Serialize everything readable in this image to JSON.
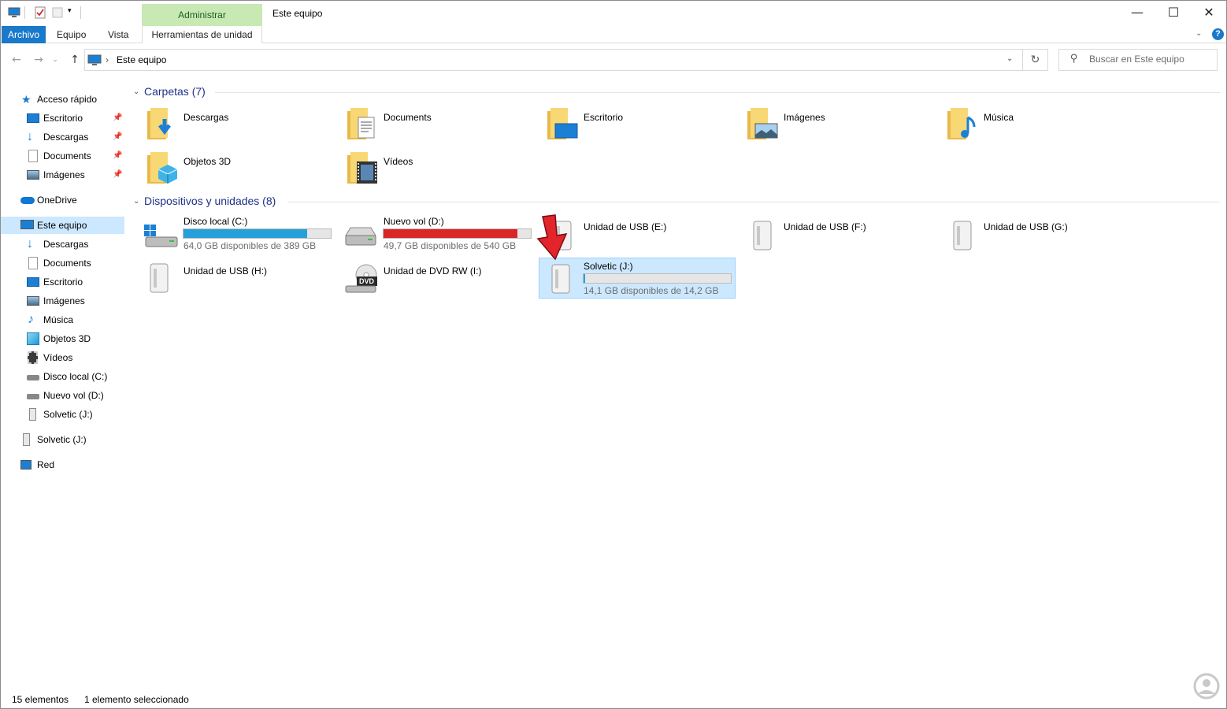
{
  "window": {
    "title": "Este equipo",
    "context_tab": "Administrar",
    "minimize": "—",
    "maximize": "☐",
    "close": "✕"
  },
  "ribbon": {
    "tabs": [
      "Archivo",
      "Equipo",
      "Vista",
      "Herramientas de unidad"
    ]
  },
  "address": {
    "path": "Este equipo",
    "separator": "›"
  },
  "search": {
    "placeholder": "Buscar en Este equipo"
  },
  "sidebar": {
    "quick_access": "Acceso rápido",
    "quick_items": [
      "Escritorio",
      "Descargas",
      "Documents",
      "Imágenes"
    ],
    "onedrive": "OneDrive",
    "this_pc": "Este equipo",
    "pc_items": [
      "Descargas",
      "Documents",
      "Escritorio",
      "Imágenes",
      "Música",
      "Objetos 3D",
      "Vídeos",
      "Disco local (C:)",
      "Nuevo vol (D:)",
      "Solvetic (J:)"
    ],
    "solvetic": "Solvetic (J:)",
    "network": "Red"
  },
  "folders": {
    "header": "Carpetas (7)",
    "items": [
      "Descargas",
      "Documents",
      "Escritorio",
      "Imágenes",
      "Música",
      "Objetos 3D",
      "Vídeos"
    ]
  },
  "devices": {
    "header": "Dispositivos y unidades (8)",
    "drives": [
      {
        "name": "Disco local (C:)",
        "free": "64,0 GB disponibles de 389 GB",
        "used_fraction": 0.84,
        "color": "#26a0da"
      },
      {
        "name": "Nuevo vol (D:)",
        "free": "49,7 GB disponibles de 540 GB",
        "used_fraction": 0.91,
        "color": "#da2626"
      },
      {
        "name": "Unidad de USB (E:)"
      },
      {
        "name": "Unidad de USB (F:)"
      },
      {
        "name": "Unidad de USB (G:)"
      },
      {
        "name": "Unidad de USB (H:)"
      },
      {
        "name": "Unidad de DVD RW (I:)"
      },
      {
        "name": "Solvetic (J:)",
        "free": "14,1 GB disponibles de 14,2 GB",
        "used_fraction": 0.01,
        "color": "#26a0da"
      }
    ],
    "dvd_label": "DVD"
  },
  "status": {
    "count": "15 elementos",
    "selected": "1 elemento seleccionado"
  },
  "colors": {
    "accent": "#1979ca",
    "selection": "#cce8ff",
    "arrow": "#e3242b"
  }
}
